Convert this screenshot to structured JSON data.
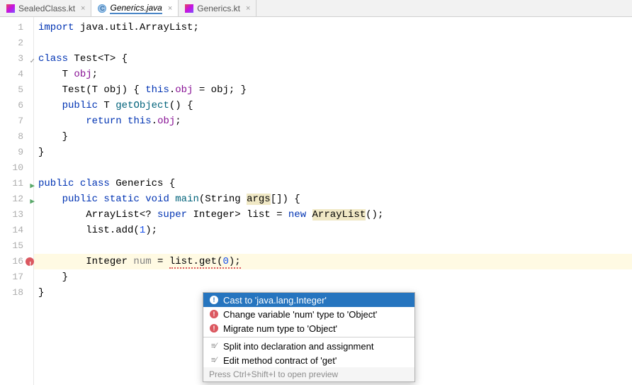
{
  "tabs": [
    {
      "label": "SealedClass.kt",
      "icon": "kotlin",
      "active": false
    },
    {
      "label": "Generics.java",
      "icon": "java",
      "active": true
    },
    {
      "label": "Generics.kt",
      "icon": "kotlin",
      "active": false
    }
  ],
  "gutter": {
    "lines": [
      "1",
      "2",
      "3",
      "4",
      "5",
      "6",
      "7",
      "8",
      "9",
      "10",
      "11",
      "12",
      "13",
      "14",
      "15",
      "16",
      "17",
      "18"
    ],
    "marks": {
      "3": "check",
      "11": "run",
      "12": "run",
      "16": "bulb"
    }
  },
  "code": {
    "l1_kw": "import",
    "l1_rest": " java.util.ArrayList;",
    "l3_kw": "class",
    "l3_name": " Test<T> {",
    "l4": "    T ",
    "l4_id": "obj",
    "l4_end": ";",
    "l5_a": "    Test(T obj) { ",
    "l5_kw": "this",
    "l5_b": ".",
    "l5_id": "obj",
    "l5_c": " = obj; }",
    "l6_a": "    ",
    "l6_kw": "public",
    "l6_b": " T ",
    "l6_fn": "getObject",
    "l6_c": "() {",
    "l7_a": "        ",
    "l7_kw1": "return",
    "l7_b": " ",
    "l7_kw2": "this",
    "l7_c": ".",
    "l7_id": "obj",
    "l7_d": ";",
    "l8": "    }",
    "l9": "}",
    "l11_kw1": "public",
    "l11_kw2": " class",
    "l11_rest": " Generics {",
    "l12_a": "    ",
    "l12_kw1": "public",
    "l12_kw2": " static",
    "l12_kw3": " void",
    "l12_b": " ",
    "l12_fn": "main",
    "l12_c": "(String ",
    "l12_param": "args",
    "l12_d": "[]) {",
    "l13_a": "        ArrayList<? ",
    "l13_kw": "super",
    "l13_b": " Integer> ",
    "l13_var": "list",
    "l13_c": " = ",
    "l13_kw2": "new",
    "l13_d": " ",
    "l13_cls": "ArrayList",
    "l13_e": "();",
    "l14_a": "        ",
    "l14_var": "list",
    "l14_b": ".add(",
    "l14_num": "1",
    "l14_c": ");",
    "l16_a": "        Integer ",
    "l16_var": "num",
    "l16_b": " = ",
    "l16_lst": "list",
    "l16_c": ".get(",
    "l16_num": "0",
    "l16_d": ");",
    "l17": "    }",
    "l18": "}"
  },
  "popup": {
    "items": [
      {
        "icon": "error",
        "label": "Cast to 'java.lang.Integer'",
        "selected": true
      },
      {
        "icon": "error",
        "label": "Change variable 'num' type to 'Object'",
        "selected": false
      },
      {
        "icon": "error",
        "label": "Migrate num type to 'Object'",
        "selected": false
      },
      {
        "icon": "intention",
        "label": "Split into declaration and assignment",
        "selected": false
      },
      {
        "icon": "intention",
        "label": "Edit method contract of 'get'",
        "selected": false
      }
    ],
    "footer": "Press Ctrl+Shift+I to open preview"
  }
}
